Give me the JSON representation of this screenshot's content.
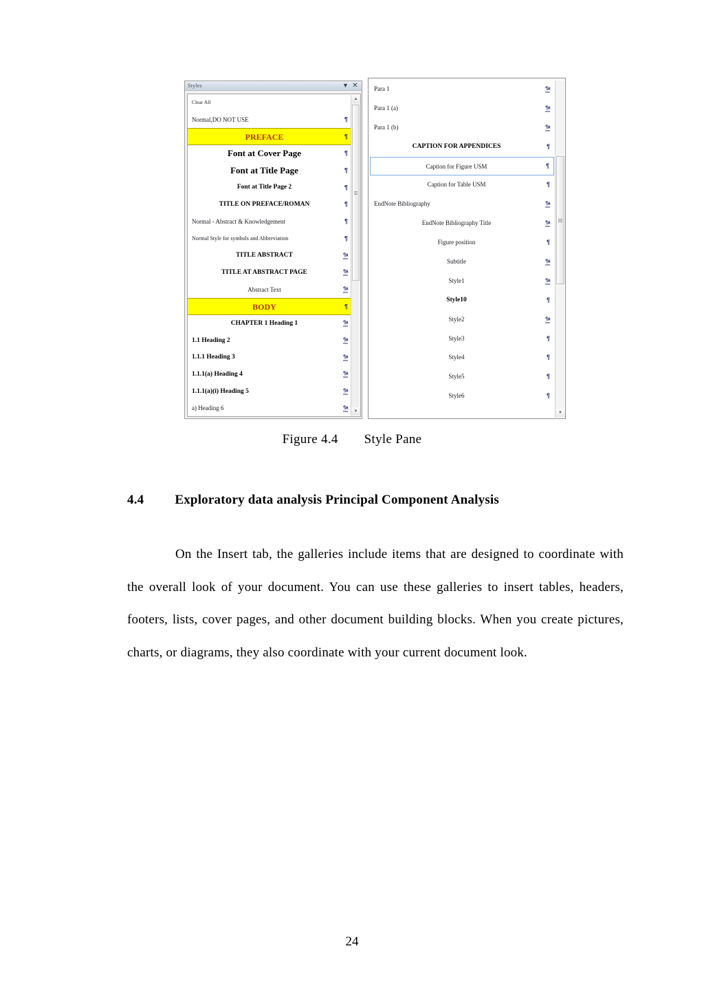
{
  "page": {
    "page_number": "24"
  },
  "figure": {
    "caption_label": "Figure 4.4",
    "caption_text": "Style Pane"
  },
  "styles_pane_left": {
    "title": "Styles",
    "dropdown_icon": "chevron-down-icon",
    "close_icon": "close-icon",
    "items": [
      {
        "label": "Clear All",
        "mark": "",
        "align": "left",
        "style": "clear-all"
      },
      {
        "label": "Normal,DO NOT USE",
        "mark": "pilcrow",
        "align": "left",
        "style": "normal"
      },
      {
        "label": "PREFACE",
        "mark": "pilcrow",
        "align": "center",
        "style": "preface-highlight"
      },
      {
        "label": "Font at Cover Page",
        "mark": "pilcrow",
        "align": "center",
        "style": "big-bold"
      },
      {
        "label": "Font at Title Page",
        "mark": "pilcrow",
        "align": "center",
        "style": "big-bold"
      },
      {
        "label": "Font at Title Page 2",
        "mark": "pilcrow",
        "align": "center",
        "style": "med-bold"
      },
      {
        "label": "TITLE ON PREFACE/ROMAN",
        "mark": "pilcrow",
        "align": "center",
        "style": "caps-bold"
      },
      {
        "label": "Normal - Abstract & Knowledgement",
        "mark": "pilcrow",
        "align": "left",
        "style": "normal"
      },
      {
        "label": "Normal Style for symbols and Abbreviation",
        "mark": "pilcrow",
        "align": "left",
        "style": "small"
      },
      {
        "label": "TITLE ABSTRACT",
        "mark": "pilcrow-a",
        "align": "center",
        "style": "caps-bold"
      },
      {
        "label": "TITLE AT ABSTRACT PAGE",
        "mark": "pilcrow-a",
        "align": "center",
        "style": "caps-bold"
      },
      {
        "label": "Abstract Text",
        "mark": "pilcrow-a",
        "align": "center",
        "style": "normal"
      },
      {
        "label": "BODY",
        "mark": "pilcrow",
        "align": "center",
        "style": "body-highlight"
      },
      {
        "label": "CHAPTER 1  Heading 1",
        "mark": "pilcrow-a",
        "align": "center",
        "style": "caps-bold"
      },
      {
        "label": "1.1  Heading 2",
        "mark": "pilcrow-a",
        "align": "left",
        "style": "med-bold"
      },
      {
        "label": "1.1.1  Heading 3",
        "mark": "pilcrow-a",
        "align": "left",
        "style": "med-bold"
      },
      {
        "label": "1.1.1(a)  Heading 4",
        "mark": "pilcrow-a",
        "align": "left",
        "style": "med-bold"
      },
      {
        "label": "1.1.1(a)(i)  Heading 5",
        "mark": "pilcrow-a",
        "align": "left",
        "style": "med-bold"
      },
      {
        "label": "a)  Heading 6",
        "mark": "pilcrow-a",
        "align": "left",
        "style": "normal"
      }
    ]
  },
  "styles_pane_right": {
    "selected_item": "Caption for Figure USM",
    "items": [
      {
        "label": "Para 1",
        "mark": "pilcrow-a",
        "align": "left",
        "style": "normal"
      },
      {
        "label": "Para 1 (a)",
        "mark": "pilcrow-a",
        "align": "left",
        "style": "normal"
      },
      {
        "label": "Para 1 (b)",
        "mark": "pilcrow-a",
        "align": "left",
        "style": "normal"
      },
      {
        "label": "CAPTION FOR APPENDICES",
        "mark": "pilcrow",
        "align": "center",
        "style": "caps-bold"
      },
      {
        "label": "Caption for Figure USM",
        "mark": "pilcrow",
        "align": "center",
        "style": "normal",
        "selected": true
      },
      {
        "label": "Caption for Table USM",
        "mark": "pilcrow",
        "align": "center",
        "style": "normal"
      },
      {
        "label": "EndNote Bibliography",
        "mark": "pilcrow-a",
        "align": "left",
        "style": "normal"
      },
      {
        "label": "EndNote Bibliography Title",
        "mark": "pilcrow-a",
        "align": "center",
        "style": "normal"
      },
      {
        "label": "Figure position",
        "mark": "pilcrow",
        "align": "center",
        "style": "normal"
      },
      {
        "label": "Subtitle",
        "mark": "pilcrow-a",
        "align": "center",
        "style": "normal"
      },
      {
        "label": "Style1",
        "mark": "pilcrow-a",
        "align": "center",
        "style": "normal"
      },
      {
        "label": "Style10",
        "mark": "pilcrow",
        "align": "center",
        "style": "med-bold"
      },
      {
        "label": "Style2",
        "mark": "pilcrow-a",
        "align": "center",
        "style": "normal"
      },
      {
        "label": "Style3",
        "mark": "pilcrow",
        "align": "center",
        "style": "normal"
      },
      {
        "label": "Style4",
        "mark": "pilcrow",
        "align": "center",
        "style": "normal"
      },
      {
        "label": "Style5",
        "mark": "pilcrow",
        "align": "center",
        "style": "normal"
      },
      {
        "label": "Style6",
        "mark": "pilcrow",
        "align": "center",
        "style": "normal"
      }
    ]
  },
  "section": {
    "number": "4.4",
    "title": "Exploratory  data analysis Principal  Component  Analysis",
    "paragraph": "On the Insert tab, the galleries  include  items  that  are designed  to coordinate  with the overall  look of your document.  You can use these  galleries  to insert  tables, headers, footers,  lists,  cover  pages,  and  other  document  building  blocks. When  you  create  pictures,  charts,  or diagrams,  they also coordinate  with  your  current  document  look."
  },
  "colors": {
    "highlight_yellow": "#ffff00",
    "highlight_text_red": "#b03000",
    "selection_border_blue": "#7aaedd",
    "mark_blue": "#2a2f7a"
  }
}
